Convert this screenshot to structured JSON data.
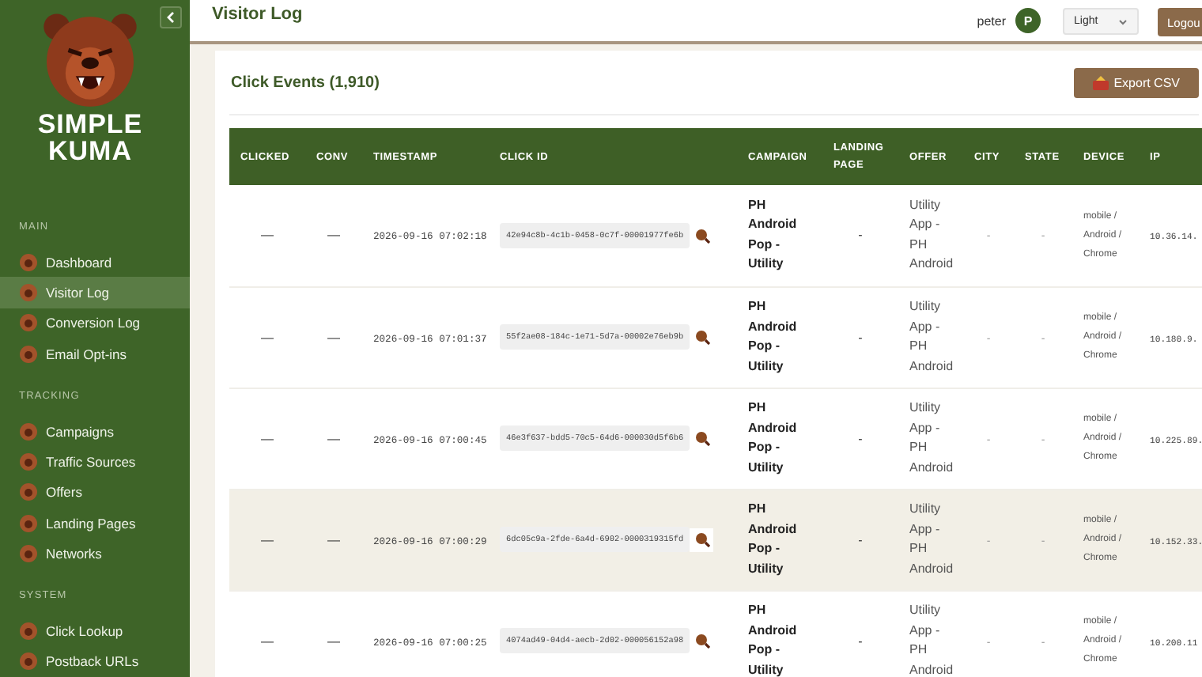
{
  "sidebar": {
    "brand": [
      "SIMPLE",
      "KUMA"
    ],
    "sections": [
      {
        "label": "MAIN",
        "items": [
          {
            "label": "Dashboard",
            "selected": false
          },
          {
            "label": "Visitor Log",
            "selected": true
          },
          {
            "label": "Conversion Log",
            "selected": false
          },
          {
            "label": "Email Opt-ins",
            "selected": false
          }
        ]
      },
      {
        "label": "TRACKING",
        "items": [
          {
            "label": "Campaigns",
            "selected": false
          },
          {
            "label": "Traffic Sources",
            "selected": false
          },
          {
            "label": "Offers",
            "selected": false
          },
          {
            "label": "Landing Pages",
            "selected": false
          },
          {
            "label": "Networks",
            "selected": false
          }
        ]
      },
      {
        "label": "SYSTEM",
        "items": [
          {
            "label": "Click Lookup",
            "selected": false
          },
          {
            "label": "Postback URLs",
            "selected": false
          }
        ]
      }
    ]
  },
  "header": {
    "title": "Visitor Log",
    "user": "peter",
    "avatar": "P",
    "theme": "Light",
    "logout": "Logou"
  },
  "card": {
    "title": "Click Events (1,910)",
    "export": "Export CSV"
  },
  "table": {
    "columns": [
      "CLICKED",
      "CONV",
      "TIMESTAMP",
      "CLICK ID",
      "CAMPAIGN",
      "LANDING PAGE",
      "OFFER",
      "CITY",
      "STATE",
      "DEVICE",
      "IP"
    ],
    "rows": [
      {
        "selected": false,
        "clicked": "—",
        "conv": "—",
        "timestamp": "2026-09-16 07:02:18",
        "click_id": "42e94c8b-4c1b-0458-0c7f-00001977fe6b",
        "campaign": "PH Android Pop - Utility",
        "landing_page": "-",
        "offer": "Utility App - PH Android",
        "city": "-",
        "state": "-",
        "device": "mobile / Android / Chrome",
        "ip": "10.36.14."
      },
      {
        "selected": false,
        "clicked": "—",
        "conv": "—",
        "timestamp": "2026-09-16 07:01:37",
        "click_id": "55f2ae08-184c-1e71-5d7a-00002e76eb9b",
        "campaign": "PH Android Pop - Utility",
        "landing_page": "-",
        "offer": "Utility App - PH Android",
        "city": "-",
        "state": "-",
        "device": "mobile / Android / Chrome",
        "ip": "10.180.9."
      },
      {
        "selected": false,
        "clicked": "—",
        "conv": "—",
        "timestamp": "2026-09-16 07:00:45",
        "click_id": "46e3f637-bdd5-70c5-64d6-000030d5f6b6",
        "campaign": "PH Android Pop - Utility",
        "landing_page": "-",
        "offer": "Utility App - PH Android",
        "city": "-",
        "state": "-",
        "device": "mobile / Android / Chrome",
        "ip": "10.225.89."
      },
      {
        "selected": true,
        "clicked": "—",
        "conv": "—",
        "timestamp": "2026-09-16 07:00:29",
        "click_id": "6dc05c9a-2fde-6a4d-6902-0000319315fd",
        "campaign": "PH Android Pop - Utility",
        "landing_page": "-",
        "offer": "Utility App - PH Android",
        "city": "-",
        "state": "-",
        "device": "mobile / Android / Chrome",
        "ip": "10.152.33."
      },
      {
        "selected": false,
        "clicked": "—",
        "conv": "—",
        "timestamp": "2026-09-16 07:00:25",
        "click_id": "4074ad49-04d4-aecb-2d02-000056152a98",
        "campaign": "PH Android Pop - Utility",
        "landing_page": "-",
        "offer": "Utility App - PH Android",
        "city": "-",
        "state": "-",
        "device": "mobile / Android / Chrome",
        "ip": "10.200.11"
      }
    ]
  }
}
